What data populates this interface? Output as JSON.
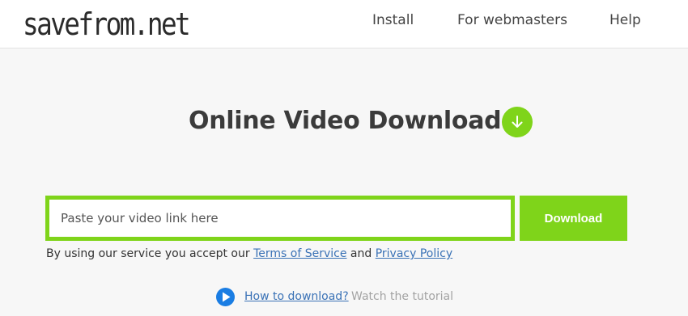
{
  "header": {
    "logo": "savefrom.net",
    "nav": [
      {
        "label": "Install"
      },
      {
        "label": "For webmasters"
      },
      {
        "label": "Help"
      }
    ]
  },
  "main": {
    "title": "Online Video Downloader",
    "title_icon": "download-arrow-icon",
    "input_placeholder": "Paste your video link here",
    "input_value": "",
    "download_label": "Download",
    "terms": {
      "prefix": "By using our service you accept our",
      "tos_link": "Terms of Service",
      "and": "and",
      "privacy_link": "Privacy Policy"
    },
    "howto": {
      "icon": "play-icon",
      "link": "How to download?",
      "text": "Watch the tutorial"
    }
  },
  "colors": {
    "accent_green": "#7fd41a",
    "link_blue": "#3a72b6",
    "play_blue": "#1a7de3"
  }
}
